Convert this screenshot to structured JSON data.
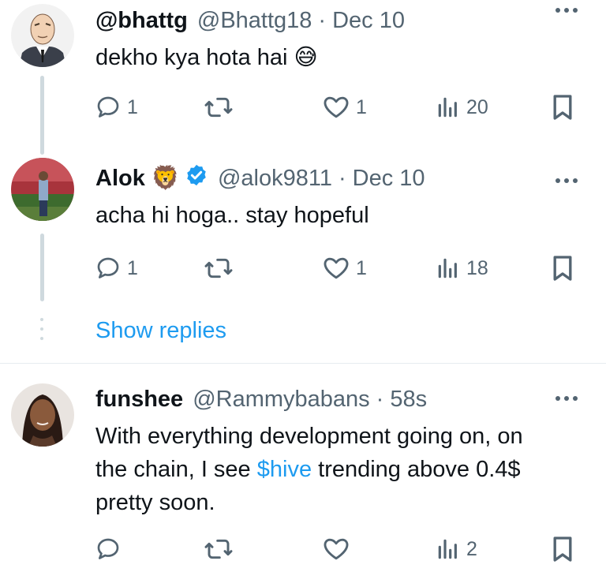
{
  "tweets": [
    {
      "name": "@bhattg",
      "handle": "@Bhattg18",
      "separator": "·",
      "time": "Dec 10",
      "text": "dekho kya hota hai",
      "text_emoji": "😅",
      "replies": "1",
      "retweets": "",
      "likes": "1",
      "views": "20"
    },
    {
      "name": "Alok",
      "name_emoji": "🦁",
      "handle": "@alok9811",
      "separator": "·",
      "time": "Dec 10",
      "text": "acha hi hoga.. stay hopeful",
      "replies": "1",
      "retweets": "",
      "likes": "1",
      "views": "18"
    },
    {
      "name": "funshee",
      "handle": "@Rammybabans",
      "separator": "·",
      "time": "58s",
      "text_line1": "With everything development going on, on",
      "text_line2_before": "the chain, I see ",
      "text_hashtag": "$hive",
      "text_line2_after": " trending above 0.4$",
      "text_line3": "pretty soon.",
      "replies": "",
      "retweets": "",
      "likes": "",
      "views": "2"
    }
  ],
  "show_replies": "Show replies",
  "icons": {
    "reply": "reply-icon",
    "retweet": "retweet-icon",
    "like": "heart-icon",
    "views": "views-icon",
    "bookmark": "bookmark-icon",
    "verified": "verified-icon",
    "more": "more-icon"
  },
  "colors": {
    "text": "#0f1419",
    "secondary": "#536471",
    "link": "#1d9bf0",
    "thread_line": "#cfd9de",
    "verified": "#1d9bf0"
  }
}
